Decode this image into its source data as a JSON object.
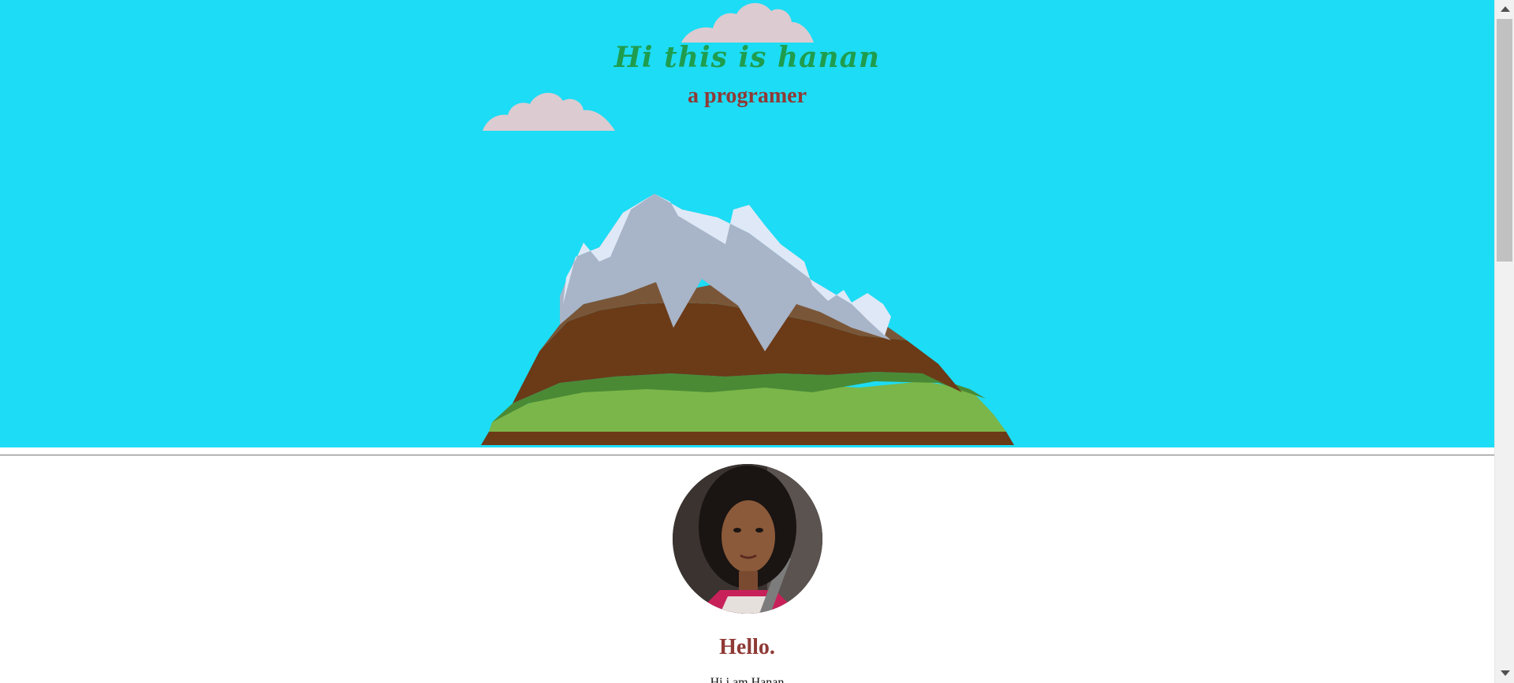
{
  "hero": {
    "title": "Hi this is hanan",
    "subtitle": "a programer",
    "background_color": "#1ddcf5",
    "icons": [
      "cloud-icon",
      "cloud-icon",
      "mountain-illustration"
    ]
  },
  "about": {
    "heading": "Hello.",
    "intro_text": "Hi i am Hanan",
    "avatar": "profile-photo"
  },
  "colors": {
    "title_green": "#1f9d4e",
    "heading_red": "#8f3a36",
    "cloud": "#dccbd1"
  }
}
